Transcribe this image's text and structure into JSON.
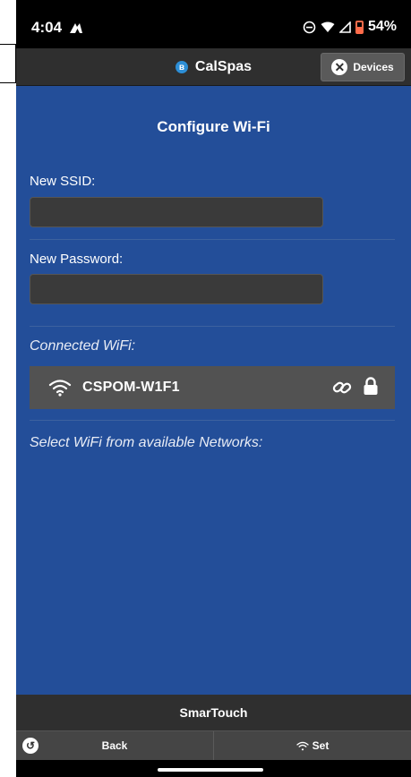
{
  "status_bar": {
    "time": "4:04",
    "battery": "54%"
  },
  "header": {
    "app_title": "CalSpas",
    "devices_label": "Devices"
  },
  "main": {
    "title": "Configure Wi-Fi",
    "ssid_label": "New SSID:",
    "ssid_value": "",
    "password_label": "New Password:",
    "password_value": "",
    "connected_label": "Connected WiFi:",
    "connected_network": "CSPOM-W1F1",
    "select_label": "Select WiFi from available Networks:"
  },
  "footer": {
    "brand": "SmarTouch",
    "back_label": "Back",
    "set_label": "Set"
  },
  "colors": {
    "main_bg": "#234e99",
    "header_bg": "#2f2f2f",
    "wifi_row_bg": "#525252",
    "battery": "#ff6b4a"
  }
}
